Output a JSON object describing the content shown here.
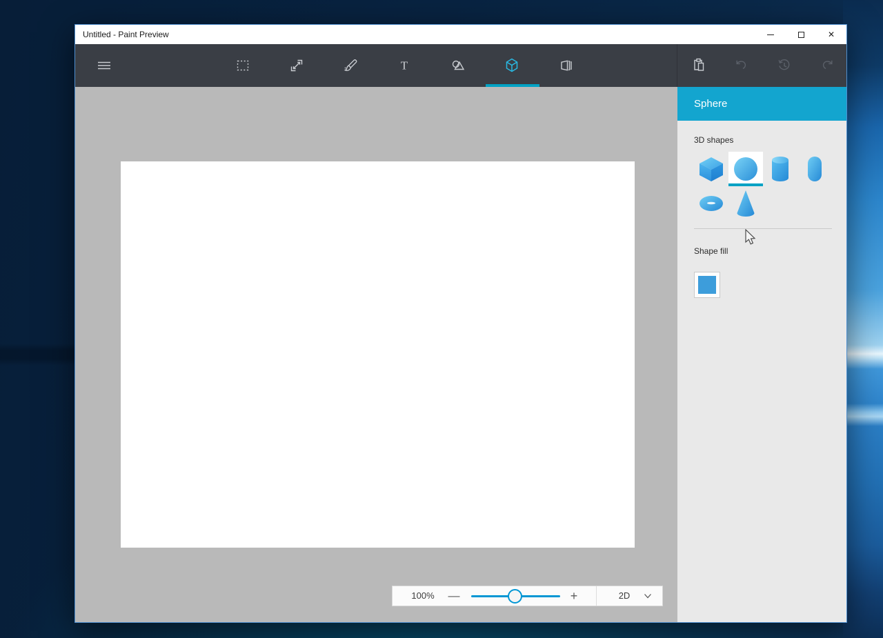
{
  "window": {
    "title": "Untitled - Paint Preview",
    "controls": {
      "minimize": "minimize",
      "maximize": "maximize",
      "close_glyph": "✕"
    }
  },
  "toolbar": {
    "active_tool": "shapes-3d",
    "tools": [
      {
        "name": "menu",
        "icon": "hamburger-icon",
        "enabled": true
      },
      {
        "name": "select",
        "icon": "marquee-select-icon",
        "enabled": true
      },
      {
        "name": "resize",
        "icon": "resize-icon",
        "enabled": true
      },
      {
        "name": "brush",
        "icon": "brush-icon",
        "enabled": true
      },
      {
        "name": "text",
        "icon": "text-icon",
        "enabled": true
      },
      {
        "name": "shapes-2d",
        "icon": "shapes-2d-icon",
        "enabled": true
      },
      {
        "name": "shapes-3d",
        "icon": "cube-3d-icon",
        "enabled": true,
        "active": true
      },
      {
        "name": "canvas",
        "icon": "canvas-icon",
        "enabled": true
      },
      {
        "name": "paste",
        "icon": "clipboard-icon",
        "enabled": true
      },
      {
        "name": "undo",
        "icon": "undo-icon",
        "enabled": false
      },
      {
        "name": "history",
        "icon": "history-icon",
        "enabled": false
      },
      {
        "name": "redo",
        "icon": "redo-icon",
        "enabled": false
      }
    ]
  },
  "panel": {
    "header": "Sphere",
    "shapes_section": {
      "label": "3D shapes",
      "items": [
        {
          "name": "cube",
          "selected": false
        },
        {
          "name": "sphere",
          "selected": true
        },
        {
          "name": "cylinder",
          "selected": false
        },
        {
          "name": "capsule",
          "selected": false
        },
        {
          "name": "doughnut",
          "selected": false
        },
        {
          "name": "cone",
          "selected": false
        }
      ]
    },
    "fill_section": {
      "label": "Shape fill",
      "swatch_color": "#3d9ddb"
    }
  },
  "zoombar": {
    "zoom_level": "100%",
    "minus_glyph": "—",
    "plus_glyph": "+",
    "slider_percent": 48,
    "mode": "2D"
  },
  "colors": {
    "panel_accent": "#13a5cf",
    "tab_underline": "#00a2c4",
    "slider": "#0096d4",
    "shape_fill_swatch": "#3d9ddb",
    "toolbar_bg": "#3a3e45"
  }
}
